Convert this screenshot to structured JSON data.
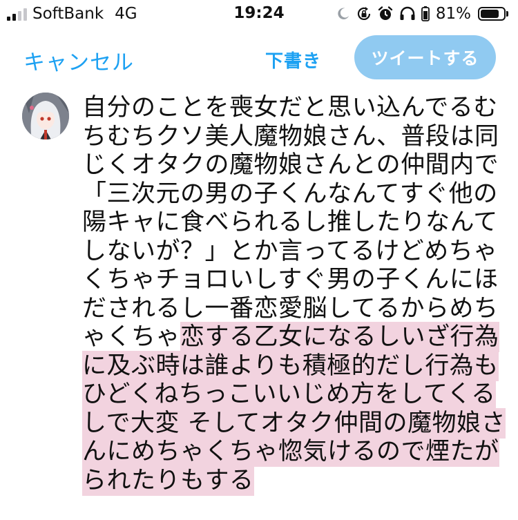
{
  "status_bar": {
    "carrier": "SoftBank",
    "network": "4G",
    "time": "19:24",
    "battery_percent": "81%",
    "battery_level": 0.81,
    "signal_bars_filled": 2,
    "signal_bars_total": 4,
    "icons": [
      "moon-icon",
      "rotation-lock-icon",
      "alarm-icon",
      "headphones-icon"
    ]
  },
  "header": {
    "cancel_label": "キャンセル",
    "drafts_label": "下書き",
    "tweet_label": "ツイートする"
  },
  "colors": {
    "accent": "#1da1f2",
    "tweet_button_disabled": "#90caf1",
    "selection_highlight": "#f2d3df"
  },
  "compose": {
    "lines": [
      {
        "plain": "自分のことを喪女だと思い込んでるむ",
        "highlight": ""
      },
      {
        "plain": "ちむちクソ美人魔物娘さん、普段は同",
        "highlight": ""
      },
      {
        "plain": "じくオタクの魔物娘さんとの仲間内で",
        "highlight": ""
      },
      {
        "plain": "「三次元の男の子くんなんてすぐ他の",
        "highlight": ""
      },
      {
        "plain": "陽キャに食べられるし推したりなんて",
        "highlight": ""
      },
      {
        "plain": "しないが？」とか言ってるけどめちゃ",
        "highlight": ""
      },
      {
        "plain": "くちゃチョロいしすぐ男の子くんにほ",
        "highlight": ""
      },
      {
        "plain": "だされるし一番恋愛脳してるからめち",
        "highlight": ""
      },
      {
        "plain": "ゃくちゃ",
        "highlight": "恋する乙女になるしいざ行為"
      },
      {
        "plain": "",
        "highlight": "に及ぶ時は誰よりも積極的だし行為も"
      },
      {
        "plain": "",
        "highlight": "ひどくねちっこいいじめ方をしてくる"
      },
      {
        "plain": "",
        "highlight": "しで大変 そしてオタク仲間の魔物娘さ"
      },
      {
        "plain": "",
        "highlight": "んにめちゃくちゃ惚気けるので煙たが"
      },
      {
        "plain": "",
        "highlight": "られたりもする"
      }
    ]
  }
}
